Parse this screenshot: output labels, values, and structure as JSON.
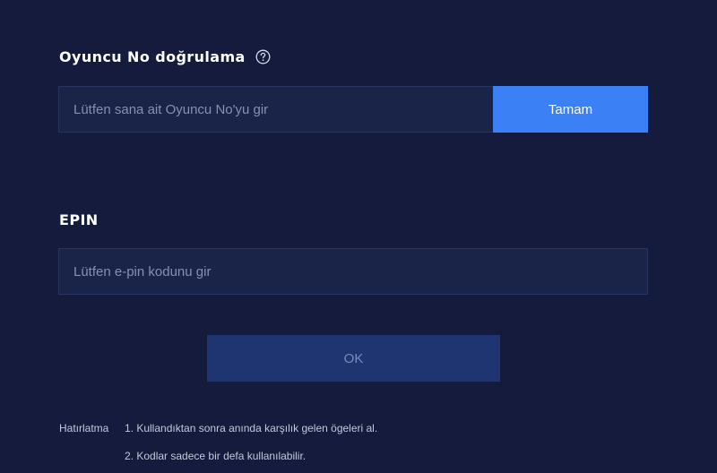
{
  "player_verification": {
    "title": "Oyuncu No doğrulama",
    "input_placeholder": "Lütfen sana ait Oyuncu No'yu gir",
    "input_value": "",
    "button_label": "Tamam",
    "help_icon": "question-circle-icon"
  },
  "epin": {
    "title": "EPIN",
    "input_placeholder": "Lütfen e-pin kodunu gir",
    "input_value": "",
    "button_label": "OK"
  },
  "reminder": {
    "label": "Hatırlatma",
    "items": [
      "1. Kullandıktan sonra anında karşılık gelen ögeleri al.",
      "2. Kodlar sadece bir defa kullanılabilir."
    ]
  },
  "colors": {
    "background": "#141b3c",
    "input_background": "#1a2348",
    "primary_button": "#3c80f6",
    "disabled_button": "#1f3572"
  }
}
